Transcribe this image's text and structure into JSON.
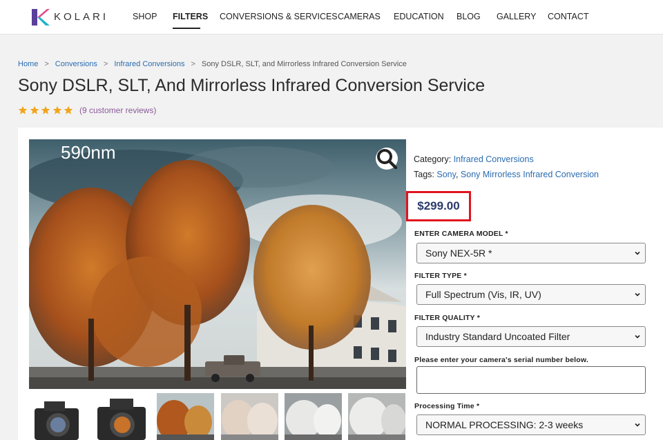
{
  "header": {
    "logo_text": "KOLARI",
    "nav": [
      {
        "label": "SHOP"
      },
      {
        "label": "FILTERS",
        "active": true
      },
      {
        "label": "CONVERSIONS & SERVICES"
      },
      {
        "label": "CAMERAS"
      },
      {
        "label": "EDUCATION"
      },
      {
        "label": "BLOG"
      },
      {
        "label": "GALLERY"
      },
      {
        "label": "CONTACT"
      }
    ]
  },
  "breadcrumb": {
    "home": "Home",
    "conversions": "Conversions",
    "infrared": "Infrared Conversions",
    "current": "Sony DSLR, SLT, and Mirrorless Infrared Conversion Service",
    "separator": ">"
  },
  "product": {
    "title": "Sony DSLR, SLT, And Mirrorless Infrared Conversion Service",
    "rating": 5,
    "reviews": "(9 customer reviews)",
    "image_label": "590nm",
    "category_label": "Category:",
    "category": "Infrared Conversions",
    "tags_label": "Tags:",
    "tag_1": "Sony",
    "tag_sep": ",",
    "tag_2": "Sony Mirrorless Infrared Conversion",
    "price": "$299.00"
  },
  "form": {
    "camera_model": {
      "label": "ENTER CAMERA MODEL *",
      "value": "Sony NEX-5R *"
    },
    "filter_type": {
      "label": "FILTER TYPE *",
      "value": "Full Spectrum (Vis, IR, UV)"
    },
    "filter_quality": {
      "label": "FILTER QUALITY *",
      "value": "Industry Standard Uncoated Filter"
    },
    "serial": {
      "label": "Please enter your camera's serial number below.",
      "value": ""
    },
    "processing": {
      "label": "Processing Time *",
      "value": "NORMAL PROCESSING: 2-3 weeks"
    }
  },
  "colors": {
    "link": "#2a6bb0",
    "price": "#2b3a6b",
    "highlight_border": "#e0141e",
    "star": "#f2a41c"
  }
}
